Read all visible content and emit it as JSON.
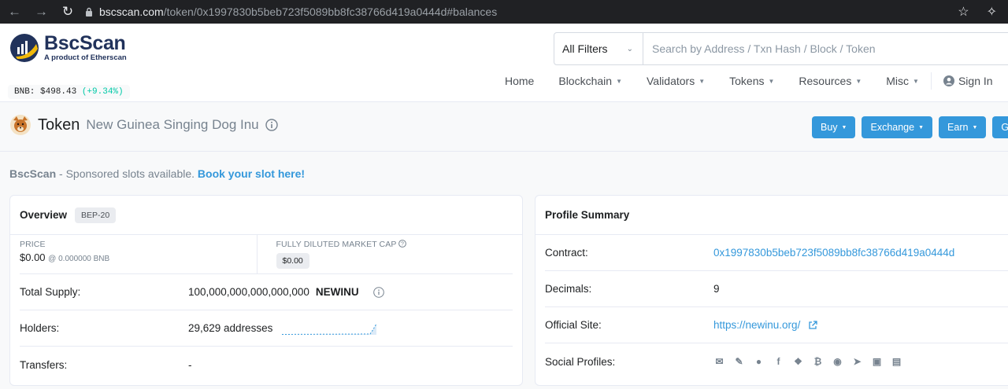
{
  "browser": {
    "url_host": "bscscan.com",
    "url_path": "/token/0x1997830b5beb723f5089bb8fc38766d419a0444d#balances"
  },
  "brand": {
    "name": "BscScan",
    "tagline": "A product of Etherscan",
    "price_label": "BNB: $498.43",
    "price_change": "(+9.34%)"
  },
  "search": {
    "filter_label": "All Filters",
    "placeholder": "Search by Address / Txn Hash / Block / Token"
  },
  "nav": {
    "home": "Home",
    "blockchain": "Blockchain",
    "validators": "Validators",
    "tokens": "Tokens",
    "resources": "Resources",
    "misc": "Misc",
    "signin": "Sign In"
  },
  "page": {
    "title": "Token",
    "token_name": "New Guinea Singing Dog Inu",
    "buttons": {
      "buy": "Buy",
      "exchange": "Exchange",
      "earn": "Earn",
      "gaming": "Ga"
    }
  },
  "sponsor": {
    "brand": "BscScan",
    "text": " - Sponsored slots available. ",
    "link": "Book your slot here!"
  },
  "overview": {
    "title": "Overview",
    "badge": "BEP-20",
    "price_label": "PRICE",
    "price_value": "$0.00",
    "price_bnb": "@ 0.000000 BNB",
    "mcap_label": "FULLY DILUTED MARKET CAP",
    "mcap_value": "$0.00",
    "supply_label": "Total Supply:",
    "supply_value": "100,000,000,000,000,000",
    "supply_symbol": "NEWINU",
    "holders_label": "Holders:",
    "holders_value": "29,629 addresses",
    "transfers_label": "Transfers:",
    "transfers_value": "-"
  },
  "profile": {
    "title": "Profile Summary",
    "contract_label": "Contract:",
    "contract_value": "0x1997830b5beb723f5089bb8fc38766d419a0444d",
    "decimals_label": "Decimals:",
    "decimals_value": "9",
    "site_label": "Official Site:",
    "site_value": "https://newinu.org/",
    "social_label": "Social Profiles:",
    "social_icons": [
      "email-icon",
      "blog-icon",
      "reddit-icon",
      "facebook-icon",
      "twitter-icon",
      "bitcointalk-icon",
      "github-icon",
      "telegram-icon",
      "discord-icon",
      "whitepaper-icon"
    ]
  }
}
